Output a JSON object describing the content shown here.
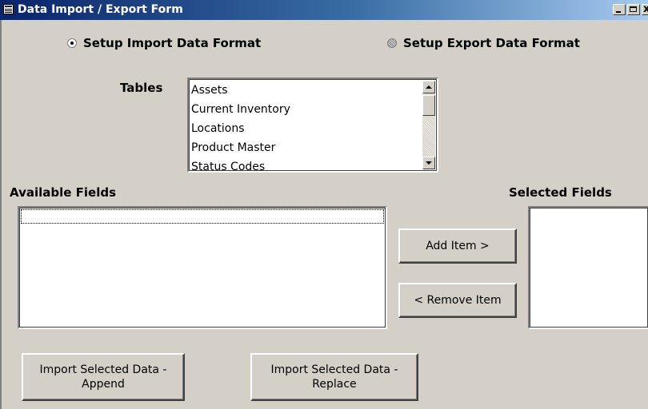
{
  "window": {
    "title": "Data Import / Export Form",
    "close_glyph": "x"
  },
  "format_options": {
    "import_label": "Setup Import Data Format",
    "export_label": "Setup Export Data Format",
    "import_selected": true
  },
  "tables": {
    "label": "Tables",
    "items": [
      "Assets",
      "Current Inventory",
      "Locations",
      "Product Master",
      "Status Codes"
    ]
  },
  "fields": {
    "available_label": "Available Fields",
    "selected_label": "Selected Fields"
  },
  "buttons": {
    "add": "Add Item >",
    "remove": "< Remove Item",
    "import_append": "Import Selected Data -\nAppend",
    "import_replace": "Import Selected Data -\nReplace"
  },
  "colors": {
    "form_background": "#d4d0c8",
    "titlebar_start": "#0a246a",
    "titlebar_end": "#a6caf0"
  }
}
